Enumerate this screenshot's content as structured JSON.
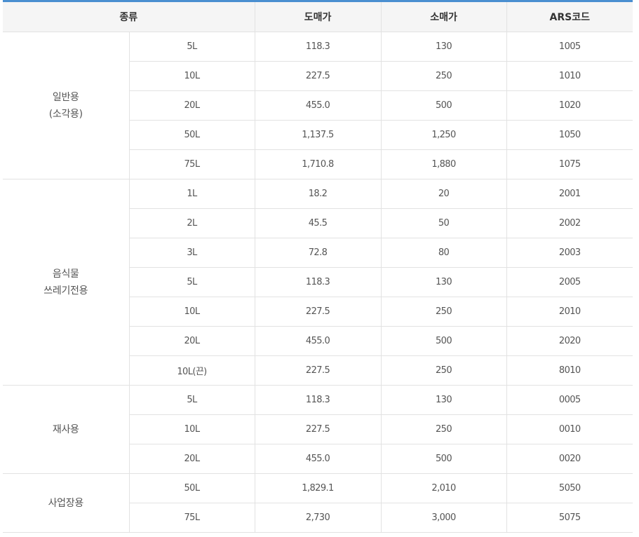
{
  "header": {
    "type": "종류",
    "wholesale": "도매가",
    "retail": "소매가",
    "ars": "ARS코드"
  },
  "groups": [
    {
      "name_lines": [
        "일반용",
        "(소각용)"
      ],
      "rows": [
        {
          "size": "5L",
          "wholesale": "118.3",
          "retail": "130",
          "ars": "1005"
        },
        {
          "size": "10L",
          "wholesale": "227.5",
          "retail": "250",
          "ars": "1010"
        },
        {
          "size": "20L",
          "wholesale": "455.0",
          "retail": "500",
          "ars": "1020"
        },
        {
          "size": "50L",
          "wholesale": "1,137.5",
          "retail": "1,250",
          "ars": "1050"
        },
        {
          "size": "75L",
          "wholesale": "1,710.8",
          "retail": "1,880",
          "ars": "1075"
        }
      ]
    },
    {
      "name_lines": [
        "음식물",
        "쓰레기전용"
      ],
      "rows": [
        {
          "size": "1L",
          "wholesale": "18.2",
          "retail": "20",
          "ars": "2001"
        },
        {
          "size": "2L",
          "wholesale": "45.5",
          "retail": "50",
          "ars": "2002"
        },
        {
          "size": "3L",
          "wholesale": "72.8",
          "retail": "80",
          "ars": "2003"
        },
        {
          "size": "5L",
          "wholesale": "118.3",
          "retail": "130",
          "ars": "2005"
        },
        {
          "size": "10L",
          "wholesale": "227.5",
          "retail": "250",
          "ars": "2010"
        },
        {
          "size": "20L",
          "wholesale": "455.0",
          "retail": "500",
          "ars": "2020"
        },
        {
          "size": "10L(끈)",
          "wholesale": "227.5",
          "retail": "250",
          "ars": "8010"
        }
      ]
    },
    {
      "name_lines": [
        "재사용"
      ],
      "rows": [
        {
          "size": "5L",
          "wholesale": "118.3",
          "retail": "130",
          "ars": "0005"
        },
        {
          "size": "10L",
          "wholesale": "227.5",
          "retail": "250",
          "ars": "0010"
        },
        {
          "size": "20L",
          "wholesale": "455.0",
          "retail": "500",
          "ars": "0020"
        }
      ]
    },
    {
      "name_lines": [
        "사업장용"
      ],
      "rows": [
        {
          "size": "50L",
          "wholesale": "1,829.1",
          "retail": "2,010",
          "ars": "5050"
        },
        {
          "size": "75L",
          "wholesale": "2,730",
          "retail": "3,000",
          "ars": "5075"
        }
      ]
    }
  ]
}
